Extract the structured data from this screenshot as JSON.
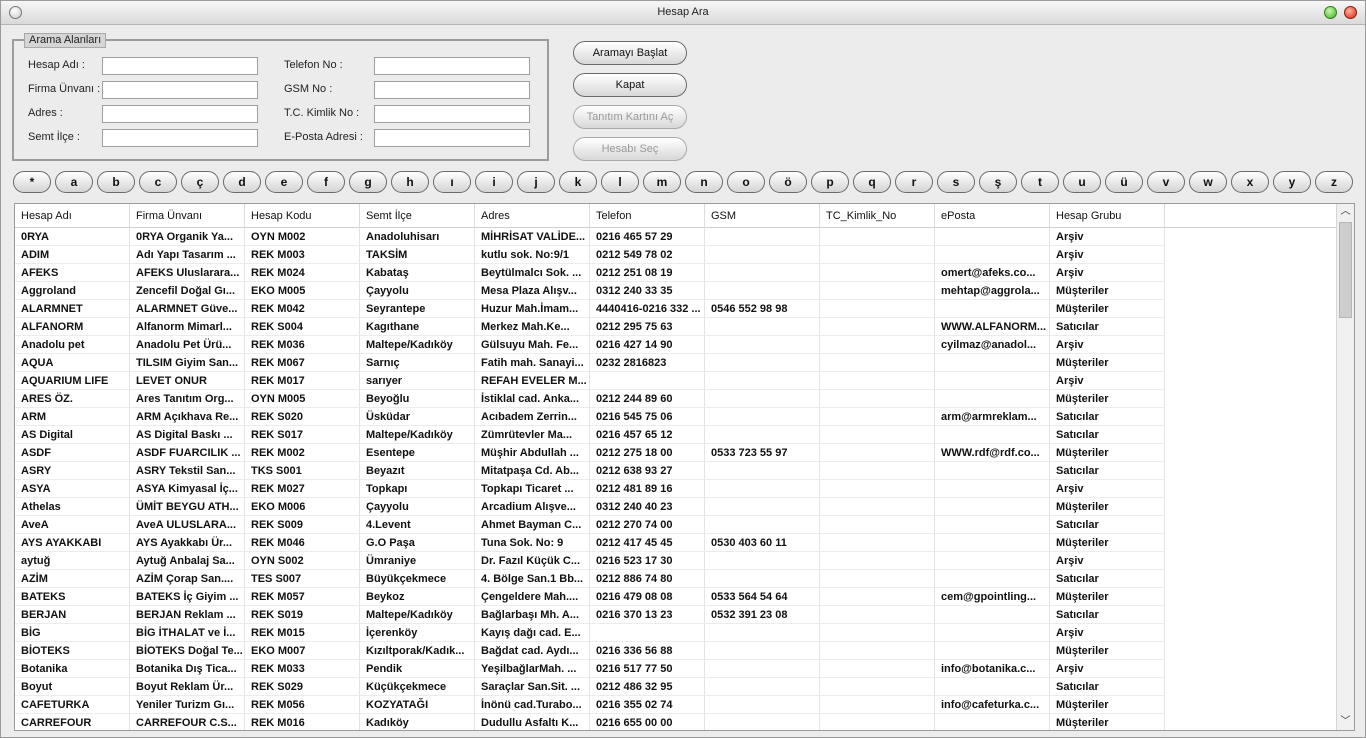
{
  "window": {
    "title": "Hesap Ara"
  },
  "search": {
    "group_title": "Arama Alanları",
    "fields": [
      {
        "label": "Hesap Adı :",
        "value": ""
      },
      {
        "label": "Firma Ünvanı :",
        "value": ""
      },
      {
        "label": "Adres :",
        "value": ""
      },
      {
        "label": "Semt İlçe :",
        "value": ""
      },
      {
        "label": "Telefon No :",
        "value": ""
      },
      {
        "label": "GSM No :",
        "value": ""
      },
      {
        "label": "T.C. Kimlik No :",
        "value": ""
      },
      {
        "label": "E-Posta Adresi :",
        "value": ""
      }
    ]
  },
  "buttons": {
    "start_search": "Aramayı Başlat",
    "close": "Kapat",
    "open_card": "Tanıtım Kartını Aç",
    "select_account": "Hesabı Seç"
  },
  "letters": [
    "*",
    "a",
    "b",
    "c",
    "ç",
    "d",
    "e",
    "f",
    "g",
    "h",
    "ı",
    "i",
    "j",
    "k",
    "l",
    "m",
    "n",
    "o",
    "ö",
    "p",
    "q",
    "r",
    "s",
    "ş",
    "t",
    "u",
    "ü",
    "v",
    "w",
    "x",
    "y",
    "z"
  ],
  "table": {
    "columns": [
      "Hesap Adı",
      "Firma Ünvanı",
      "Hesap Kodu",
      "Semt İlçe",
      "Adres",
      "Telefon",
      "GSM",
      "TC_Kimlik_No",
      "ePosta",
      "Hesap Grubu"
    ],
    "rows": [
      [
        "0RYA",
        "0RYA Organik Ya...",
        "OYN M002",
        "Anadoluhisarı",
        "MİHRİSAT VALİDE...",
        "0216 465 57 29",
        "",
        "",
        "",
        "Arşiv"
      ],
      [
        "ADIM",
        "Adı Yapı Tasarım ...",
        "REK M003",
        "TAKSİM",
        "kutlu sok. No:9/1",
        "0212 549 78 02",
        "",
        "",
        "",
        "Arşiv"
      ],
      [
        "AFEKS",
        "AFEKS Uluslarara...",
        "REK M024",
        "Kabataş",
        "Beytülmalcı Sok. ...",
        "0212 251 08 19",
        "",
        "",
        "omert@afeks.co...",
        "Arşiv"
      ],
      [
        "Aggroland",
        "Zencefil Doğal Gı...",
        "EKO M005",
        "Çayyolu",
        "Mesa Plaza Alışv...",
        "0312 240 33 35",
        "",
        "",
        "mehtap@aggrola...",
        "Müşteriler"
      ],
      [
        "ALARMNET",
        "ALARMNET Güve...",
        "REK M042",
        "Seyrantepe",
        "Huzur Mah.İmam...",
        "4440416-0216 332 ...",
        "0546 552 98 98",
        "",
        "",
        "Müşteriler"
      ],
      [
        "ALFANORM",
        "Alfanorm Mimarl...",
        "REK S004",
        "Kagıthane",
        "Merkez Mah.Ke...",
        "0212 295 75 63",
        "",
        "",
        "WWW.ALFANORM...",
        "Satıcılar"
      ],
      [
        "Anadolu pet",
        "Anadolu Pet Ürü...",
        "REK M036",
        "Maltepe/Kadıköy",
        "Gülsuyu Mah. Fe...",
        "0216 427 14 90",
        "",
        "",
        "cyilmaz@anadol...",
        "Arşiv"
      ],
      [
        "AQUA",
        "TILSIM Giyim San...",
        "REK M067",
        "Sarnıç",
        "Fatih mah. Sanayi...",
        "0232 2816823",
        "",
        "",
        "",
        "Müşteriler"
      ],
      [
        "AQUARIUM LIFE",
        "LEVET ONUR",
        "REK M017",
        "sarıyer",
        "REFAH EVELER M...",
        "",
        "",
        "",
        "",
        "Arşiv"
      ],
      [
        "ARES ÖZ.",
        "Ares Tanıtım Org...",
        "OYN M005",
        "Beyoğlu",
        "İstiklal cad. Anka...",
        "0212 244 89 60",
        "",
        "",
        "",
        "Müşteriler"
      ],
      [
        "ARM",
        "ARM Açıkhava Re...",
        "REK S020",
        "Üsküdar",
        "Acıbadem Zerrin...",
        "0216 545 75 06",
        "",
        "",
        "arm@armreklam...",
        "Satıcılar"
      ],
      [
        "AS Digital",
        "AS Digital Baskı ...",
        "REK S017",
        "Maltepe/Kadıköy",
        "Zümrütevler Ma...",
        "0216 457 65 12",
        "",
        "",
        "",
        "Satıcılar"
      ],
      [
        "ASDF",
        "ASDF FUARCILIK ...",
        "REK M002",
        "Esentepe",
        "Müşhir Abdullah ...",
        "0212 275 18 00",
        "0533 723 55 97",
        "",
        "WWW.rdf@rdf.co...",
        "Müşteriler"
      ],
      [
        "ASRY",
        "ASRY Tekstil San...",
        "TKS S001",
        "Beyazıt",
        "Mitatpaşa Cd. Ab...",
        "0212 638 93 27",
        "",
        "",
        "",
        "Satıcılar"
      ],
      [
        "ASYA",
        "ASYA Kimyasal İç...",
        "REK M027",
        "Topkapı",
        "Topkapı Ticaret ...",
        "0212 481 89 16",
        "",
        "",
        "",
        "Arşiv"
      ],
      [
        "Athelas",
        "ÜMİT BEYGU ATH...",
        "EKO M006",
        "Çayyolu",
        "Arcadium Alışve...",
        "0312 240 40 23",
        "",
        "",
        "",
        "Müşteriler"
      ],
      [
        "AveA",
        "AveA ULUSLARA...",
        "REK S009",
        "4.Levent",
        "Ahmet Bayman C...",
        "0212 270 74 00",
        "",
        "",
        "",
        "Satıcılar"
      ],
      [
        "AYS AYAKKABI",
        "AYS Ayakkabı Ür...",
        "REK M046",
        "G.O Paşa",
        "Tuna Sok. No: 9",
        "0212 417 45 45",
        "0530 403 60 11",
        "",
        "",
        "Müşteriler"
      ],
      [
        "aytuğ",
        "Aytuğ Anbalaj Sa...",
        "OYN S002",
        "Ümraniye",
        "Dr. Fazıl Küçük C...",
        "0216 523 17 30",
        "",
        "",
        "",
        "Arşiv"
      ],
      [
        "AZİM",
        "AZİM Çorap San....",
        "TES S007",
        "Büyükçekmece",
        "4. Bölge San.1 Bb...",
        "0212 886 74 80",
        "",
        "",
        "",
        "Satıcılar"
      ],
      [
        "BATEKS",
        "BATEKS İç Giyim ...",
        "REK M057",
        "Beykoz",
        "Çengeldere Mah....",
        "0216 479 08 08",
        "0533 564 54 64",
        "",
        "cem@gpointling...",
        "Müşteriler"
      ],
      [
        "BERJAN",
        "BERJAN Reklam ...",
        "REK S019",
        "Maltepe/Kadıköy",
        "Bağlarbaşı Mh. A...",
        "0216 370 13 23",
        "0532 391 23 08",
        "",
        "",
        "Satıcılar"
      ],
      [
        "BİG",
        "BİG İTHALAT ve İ...",
        "REK M015",
        "İçerenköy",
        "Kayış dağı cad. E...",
        "",
        "",
        "",
        "",
        "Arşiv"
      ],
      [
        "BİOTEKS",
        "BİOTEKS Doğal Te...",
        "EKO M007",
        "Kızıltporak/Kadık...",
        "Bağdat cad. Aydı...",
        "0216 336 56 88",
        "",
        "",
        "",
        "Müşteriler"
      ],
      [
        "Botanika",
        "Botanika Dış Tica...",
        "REK M033",
        "Pendik",
        "YeşilbağlarMah. ...",
        "0216 517 77 50",
        "",
        "",
        "info@botanika.c...",
        "Arşiv"
      ],
      [
        "Boyut",
        "Boyut Reklam Ür...",
        "REK S029",
        "Küçükçekmece",
        "Saraçlar San.Sit. ...",
        "0212 486 32 95",
        "",
        "",
        "",
        "Satıcılar"
      ],
      [
        "CAFETURKA",
        "Yeniler Turizm Gı...",
        "REK M056",
        "KOZYATAĞI",
        "İnönü cad.Turabo...",
        "0216 355 02 74",
        "",
        "",
        "info@cafeturka.c...",
        "Müşteriler"
      ],
      [
        "CARREFOUR",
        "CARREFOUR   C.S...",
        "REK M016",
        "Kadıköy",
        "Dudullu Asfaltı K...",
        "0216 655 00 00",
        "",
        "",
        "",
        "Müşteriler"
      ]
    ]
  }
}
